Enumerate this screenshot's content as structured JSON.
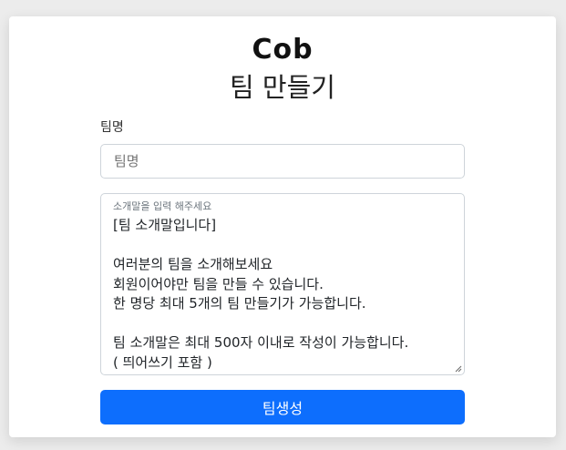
{
  "logo": {
    "text": "Cob"
  },
  "page_title": "팀 만들기",
  "team_name": {
    "label": "팀명",
    "value": "",
    "placeholder": "팀명"
  },
  "intro": {
    "floating_label": "소개말을 입력 해주세요",
    "value": "[팀 소개말입니다]\n\n여러분의 팀을 소개해보세요\n회원이어야만 팀을 만들 수 있습니다.\n한 명당 최대 5개의 팀 만들기가 가능합니다.\n\n팀 소개말은 최대 500자 이내로 작성이 가능합니다.\n( 띄어쓰기 포함 )"
  },
  "submit": {
    "label": "팀생성"
  },
  "colors": {
    "primary": "#0d6efd",
    "background": "#ececec",
    "card": "#ffffff"
  }
}
